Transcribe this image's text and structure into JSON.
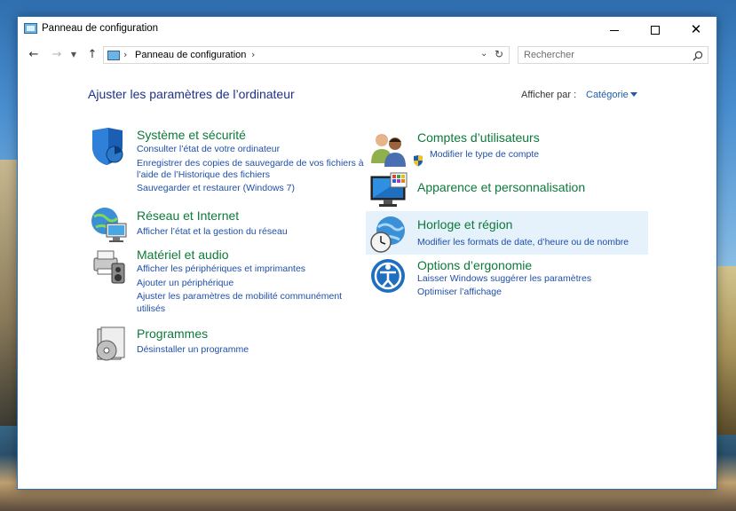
{
  "window": {
    "title": "Panneau de configuration"
  },
  "address": {
    "crumb": "Panneau de configuration"
  },
  "search": {
    "placeholder": "Rechercher"
  },
  "header": {
    "heading": "Ajuster les paramètres de l’ordinateur",
    "view_by_label": "Afficher par :",
    "view_by_value": "Catégorie"
  },
  "categories_left": [
    {
      "title": "Système et sécurité",
      "icon": "shield-icon",
      "links": [
        "Consulter l’état de votre ordinateur",
        "Enregistrer des copies de sauvegarde de vos fichiers à",
        "l’aide de l’Historique des fichiers",
        "Sauvegarder et restaurer (Windows 7)"
      ]
    },
    {
      "title": "Réseau et Internet",
      "icon": "network-globe-icon",
      "links": [
        "Afficher l’état et la gestion du réseau"
      ]
    },
    {
      "title": "Matériel et audio",
      "icon": "printer-speaker-icon",
      "links": [
        "Afficher les périphériques et imprimantes",
        "Ajouter un périphérique",
        "Ajuster les paramètres de mobilité communément",
        "utilisés"
      ]
    },
    {
      "title": "Programmes",
      "icon": "programs-disc-icon",
      "links": [
        "Désinstaller un programme"
      ]
    }
  ],
  "categories_right": [
    {
      "title": "Comptes d’utilisateurs",
      "icon": "users-icon",
      "links": [
        "Modifier le type de compte"
      ]
    },
    {
      "title": "Apparence et personnalisation",
      "icon": "monitor-palette-icon",
      "links": []
    },
    {
      "title": "Horloge et région",
      "icon": "clock-globe-icon",
      "links": [
        "Modifier les formats de date, d’heure ou de nombre"
      ]
    },
    {
      "title": "Options d’ergonomie",
      "icon": "ease-of-access-icon",
      "links": [
        "Laisser Windows suggérer les paramètres",
        "Optimiser l’affichage"
      ]
    }
  ],
  "colors": {
    "category_title": "#0d7a3a",
    "link": "#1f4fa8",
    "heading": "#1e3287",
    "hover": "#e5f1fb"
  }
}
